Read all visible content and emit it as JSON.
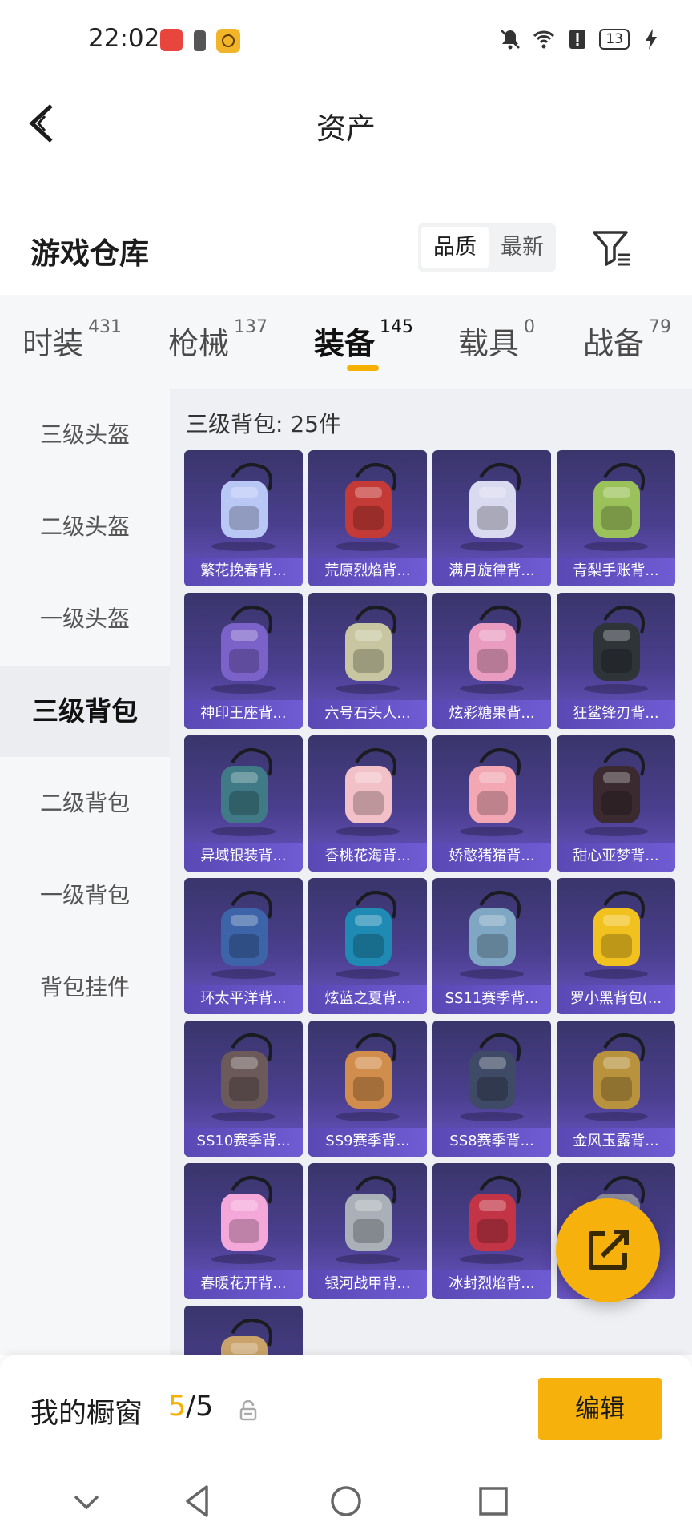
{
  "status_bar": {
    "time": "22:02",
    "battery": "13"
  },
  "header": {
    "title": "资产"
  },
  "warehouse": {
    "title": "游戏仓库",
    "sort_options": [
      "品质",
      "最新"
    ]
  },
  "tabs": [
    {
      "label": "时装",
      "count": "431"
    },
    {
      "label": "枪械",
      "count": "137"
    },
    {
      "label": "装备",
      "count": "145"
    },
    {
      "label": "载具",
      "count": "0"
    },
    {
      "label": "战备",
      "count": "79"
    }
  ],
  "active_tab": "装备",
  "sidebar": {
    "items": [
      "三级头盔",
      "二级头盔",
      "一级头盔",
      "三级背包",
      "二级背包",
      "一级背包",
      "背包挂件"
    ],
    "active": "三级背包"
  },
  "section": {
    "title": "三级背包: 25件"
  },
  "items": [
    {
      "name": "繁花挽春背...",
      "accent": "#b9c7f5"
    },
    {
      "name": "荒原烈焰背...",
      "accent": "#c43a36"
    },
    {
      "name": "满月旋律背...",
      "accent": "#d9d9ef"
    },
    {
      "name": "青梨手账背...",
      "accent": "#9bc25a"
    },
    {
      "name": "神印王座背...",
      "accent": "#7a62c9"
    },
    {
      "name": "六号石头人...",
      "accent": "#c7c6a0"
    },
    {
      "name": "炫彩糖果背...",
      "accent": "#e99bc0"
    },
    {
      "name": "狂鲨锋刃背...",
      "accent": "#2f3439"
    },
    {
      "name": "异域银装背...",
      "accent": "#3f7a86"
    },
    {
      "name": "香桃花海背...",
      "accent": "#f2c1c7"
    },
    {
      "name": "娇憨猪猪背...",
      "accent": "#f2a7b2"
    },
    {
      "name": "甜心亚梦背...",
      "accent": "#3b2b30"
    },
    {
      "name": "环太平洋背...",
      "accent": "#3d64a8"
    },
    {
      "name": "炫蓝之夏背...",
      "accent": "#1f8bb4"
    },
    {
      "name": "SS11赛季背...",
      "accent": "#7fa6c2"
    },
    {
      "name": "罗小黑背包(...",
      "accent": "#f1c21f"
    },
    {
      "name": "SS10赛季背...",
      "accent": "#6c5a5a"
    },
    {
      "name": "SS9赛季背...",
      "accent": "#d18d4b"
    },
    {
      "name": "SS8赛季背...",
      "accent": "#3f4a66"
    },
    {
      "name": "金风玉露背...",
      "accent": "#b8923d"
    },
    {
      "name": "春暖花开背...",
      "accent": "#f4a7d9"
    },
    {
      "name": "银河战甲背...",
      "accent": "#a9b0b8"
    },
    {
      "name": "冰封烈焰背...",
      "accent": "#c23446"
    },
    {
      "name": "",
      "accent": "#8c8c9c"
    },
    {
      "name": "",
      "accent": "#c9a36a"
    }
  ],
  "showcase": {
    "title": "我的橱窗",
    "current": "5",
    "total": "/5",
    "edit_label": "编辑"
  },
  "colors": {
    "accent": "#f5b000",
    "card_top": "#3a356b",
    "card_bottom": "#6b55c6"
  }
}
